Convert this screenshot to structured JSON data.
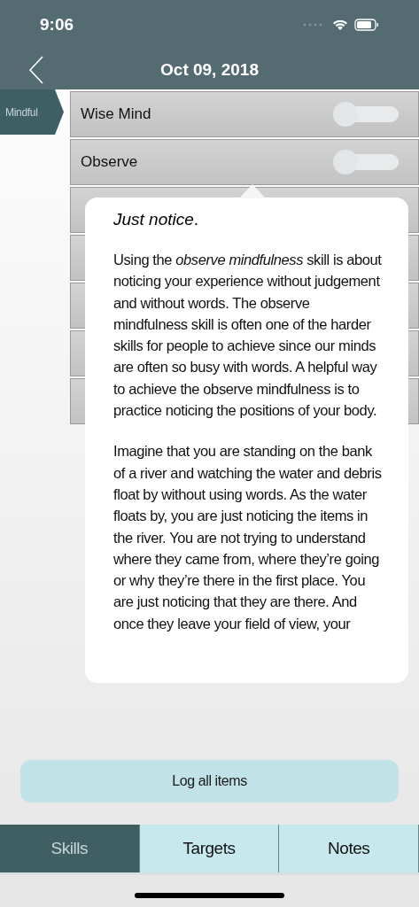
{
  "status_bar": {
    "time": "9:06"
  },
  "nav": {
    "title": "Oct 09, 2018"
  },
  "category": {
    "label": "Mindful"
  },
  "skills": [
    {
      "kind": "toggle",
      "label": "Wise Mind",
      "on": false
    },
    {
      "kind": "toggle",
      "label": "Observe",
      "on": false
    },
    {
      "kind": "covered"
    },
    {
      "kind": "covered"
    },
    {
      "kind": "covered"
    },
    {
      "kind": "covered"
    },
    {
      "kind": "covered"
    }
  ],
  "popover": {
    "title": "*Just notice*.",
    "paragraphs": [
      "Using the *observe mindfulness* skill is about noticing your experience without judgement and without words. The observe mindfulness skill is often one of the harder skills for people to achieve since our minds are often so busy with words. A helpful way to achieve the observe mindfulness is to practice noticing the positions of your body.",
      "Imagine that you are standing on the bank of a river and watching the water and debris float by without using words. As the water floats by, you are just noticing the items in the river. You are not trying to understand where they came from, where they’re going or why they’re there in the first place. You are just noticing that they are there. And once they leave your field of view, your"
    ]
  },
  "log_button": {
    "label": "Log all items"
  },
  "tabs": [
    {
      "label": "Skills",
      "selected": true
    },
    {
      "label": "Targets",
      "selected": false
    },
    {
      "label": "Notes",
      "selected": false
    }
  ]
}
